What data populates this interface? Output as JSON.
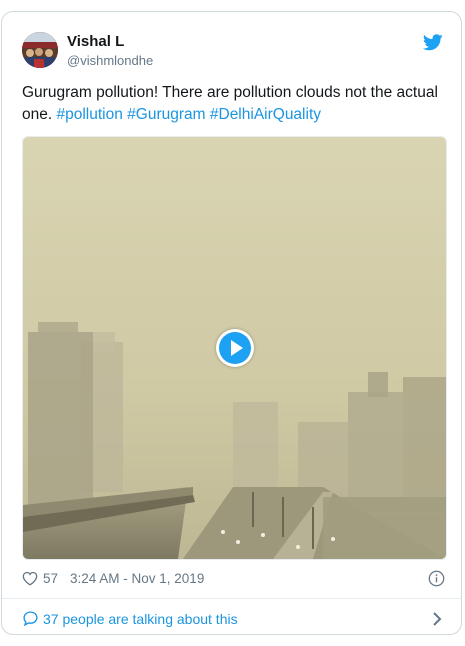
{
  "tweet": {
    "author_name": "Vishal L",
    "author_handle": "@vishmlondhe",
    "text_plain": "Gurugram pollution! There are pollution clouds not the actual one. ",
    "hashtags": [
      "#pollution",
      "#Gurugram",
      "#DelhiAirQuality"
    ],
    "likes": "57",
    "timestamp": "3:24 AM - Nov 1, 2019",
    "talking_label": "37 people are talking about this"
  },
  "icons": {
    "bird": "twitter-bird-icon",
    "play": "play-icon",
    "heart": "heart-icon",
    "info": "info-icon",
    "bubble": "speech-bubble-icon",
    "chevron": "chevron-right-icon"
  },
  "colors": {
    "link": "#1b95e0",
    "muted": "#657786",
    "border": "#cfd9de"
  }
}
